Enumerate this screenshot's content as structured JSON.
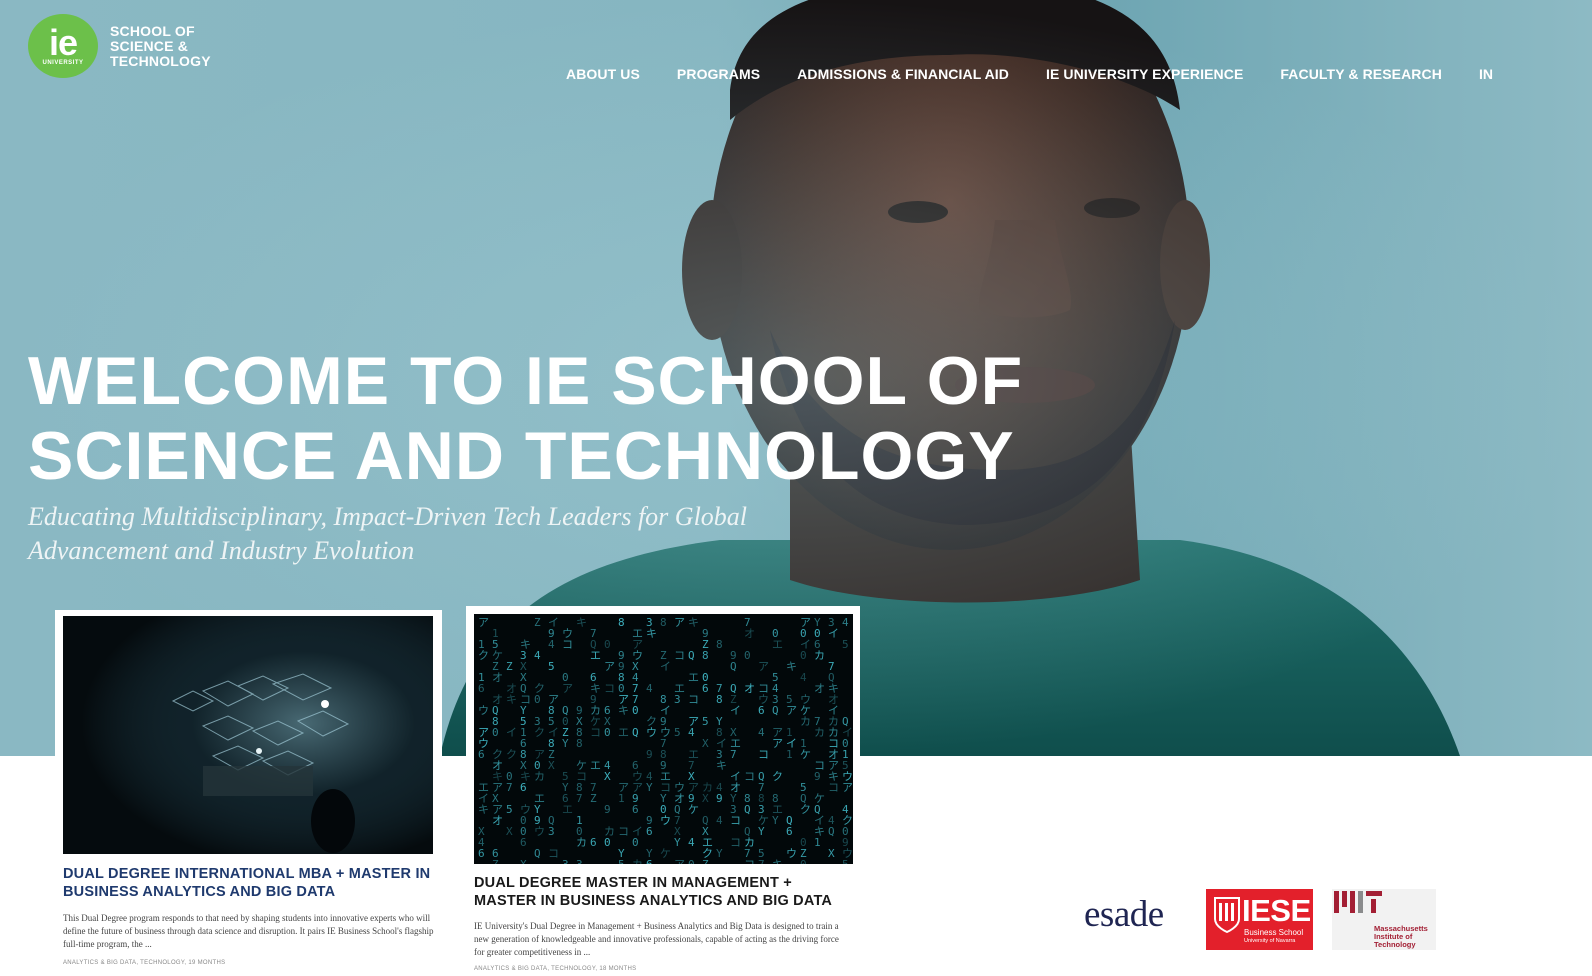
{
  "header": {
    "logo": {
      "mark": "ie",
      "mark_sub": "UNIVERSITY",
      "lines": [
        "SCHOOL OF",
        "SCIENCE &",
        "TECHNOLOGY"
      ]
    },
    "nav": [
      {
        "label": "ABOUT US"
      },
      {
        "label": "PROGRAMS"
      },
      {
        "label": "ADMISSIONS & FINANCIAL AID"
      },
      {
        "label": "IE UNIVERSITY EXPERIENCE"
      },
      {
        "label": "FACULTY & RESEARCH"
      },
      {
        "label": "IN"
      }
    ]
  },
  "hero": {
    "title_lines": [
      "WELCOME TO IE SCHOOL OF",
      "SCIENCE AND TECHNOLOGY"
    ],
    "subtitle_lines": [
      "Educating Multidisciplinary, Impact-Driven Tech Leaders for Global",
      "Advancement and Industry Evolution"
    ]
  },
  "programs": [
    {
      "title_lines": [
        "DUAL DEGREE INTERNATIONAL MBA + MASTER IN",
        "BUSINESS ANALYTICS AND BIG DATA"
      ],
      "desc_lines": [
        "This Dual Degree program responds to that need by shaping students into innovative experts who will",
        "define the future of business through data science and disruption. It pairs IE Business School's flagship",
        "full-time program, the ..."
      ],
      "meta": "ANALYTICS & BIG DATA, TECHNOLOGY,   19 MONTHS",
      "title_color": "#1f3a6e"
    },
    {
      "title_lines": [
        "DUAL DEGREE MASTER IN MANAGEMENT +",
        "MASTER IN BUSINESS ANALYTICS AND BIG DATA"
      ],
      "desc_lines": [
        "IE University's Dual Degree in Management + Business Analytics and Big Data is designed to train a",
        "new generation of knowledgeable and innovative professionals, capable of acting as the driving force",
        "for greater competitiveness in ..."
      ],
      "meta": "ANALYTICS & BIG DATA, TECHNOLOGY,   18 MONTHS",
      "title_color": "#1a1a1a"
    }
  ],
  "partners": {
    "esade": "esade",
    "iese": {
      "word": "IESE",
      "line1": "Business School",
      "line2": "University of Navarra"
    },
    "mit": {
      "lines": [
        "Massachusetts",
        "Institute of",
        "Technology"
      ]
    }
  },
  "colors": {
    "brand_green": "#6cc04a",
    "hero_bg": "#88b7c2",
    "iese_red": "#e3202b",
    "mit_red": "#a31f34",
    "esade_navy": "#1f2552"
  }
}
